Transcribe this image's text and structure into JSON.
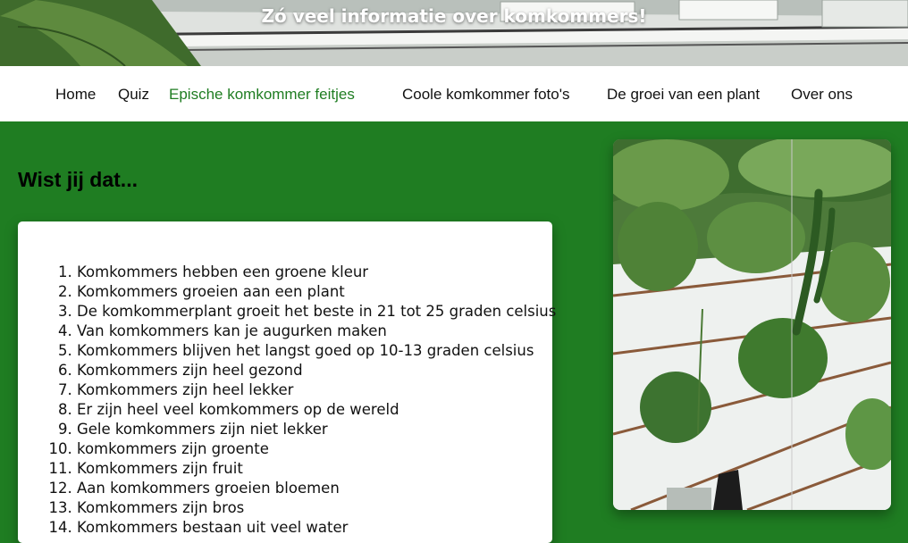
{
  "banner": {
    "title": "Zó veel informatie over komkommers!",
    "image": "greenhouse-cucumber-rows-photo"
  },
  "nav": {
    "items": [
      {
        "label": "Home"
      },
      {
        "label": "Quiz"
      },
      {
        "label": "Epische komkommer feitjes",
        "active": true
      },
      {
        "label": "Coole komkommer foto's"
      },
      {
        "label": "De groei van een plant"
      },
      {
        "label": "Over ons"
      }
    ]
  },
  "main": {
    "heading": "Wist jij dat...",
    "facts": [
      "Komkommers hebben een groene kleur",
      "Komkommers groeien aan een plant",
      "De komkommerplant groeit het beste in 21 tot 25 graden celsius",
      "Van komkommers kan je augurken maken",
      "Komkommers blijven het langst goed op 10-13 graden celsius",
      "Komkommers zijn heel gezond",
      "Komkommers zijn heel lekker",
      "Er zijn heel veel komkommers op de wereld",
      "Gele komkommers zijn niet lekker",
      "komkommers zijn groente",
      "Komkommers zijn fruit",
      "Aan komkommers groeien bloemen",
      "Komkommers zijn bros",
      "Komkommers bestaan uit veel water"
    ]
  },
  "photo": {
    "image": "cucumber-plant-greenhouse-photo"
  },
  "colors": {
    "page_background": "#1f7d22",
    "nav_active": "#1f7d22",
    "nav_text": "#111111",
    "card_background": "#ffffff"
  }
}
